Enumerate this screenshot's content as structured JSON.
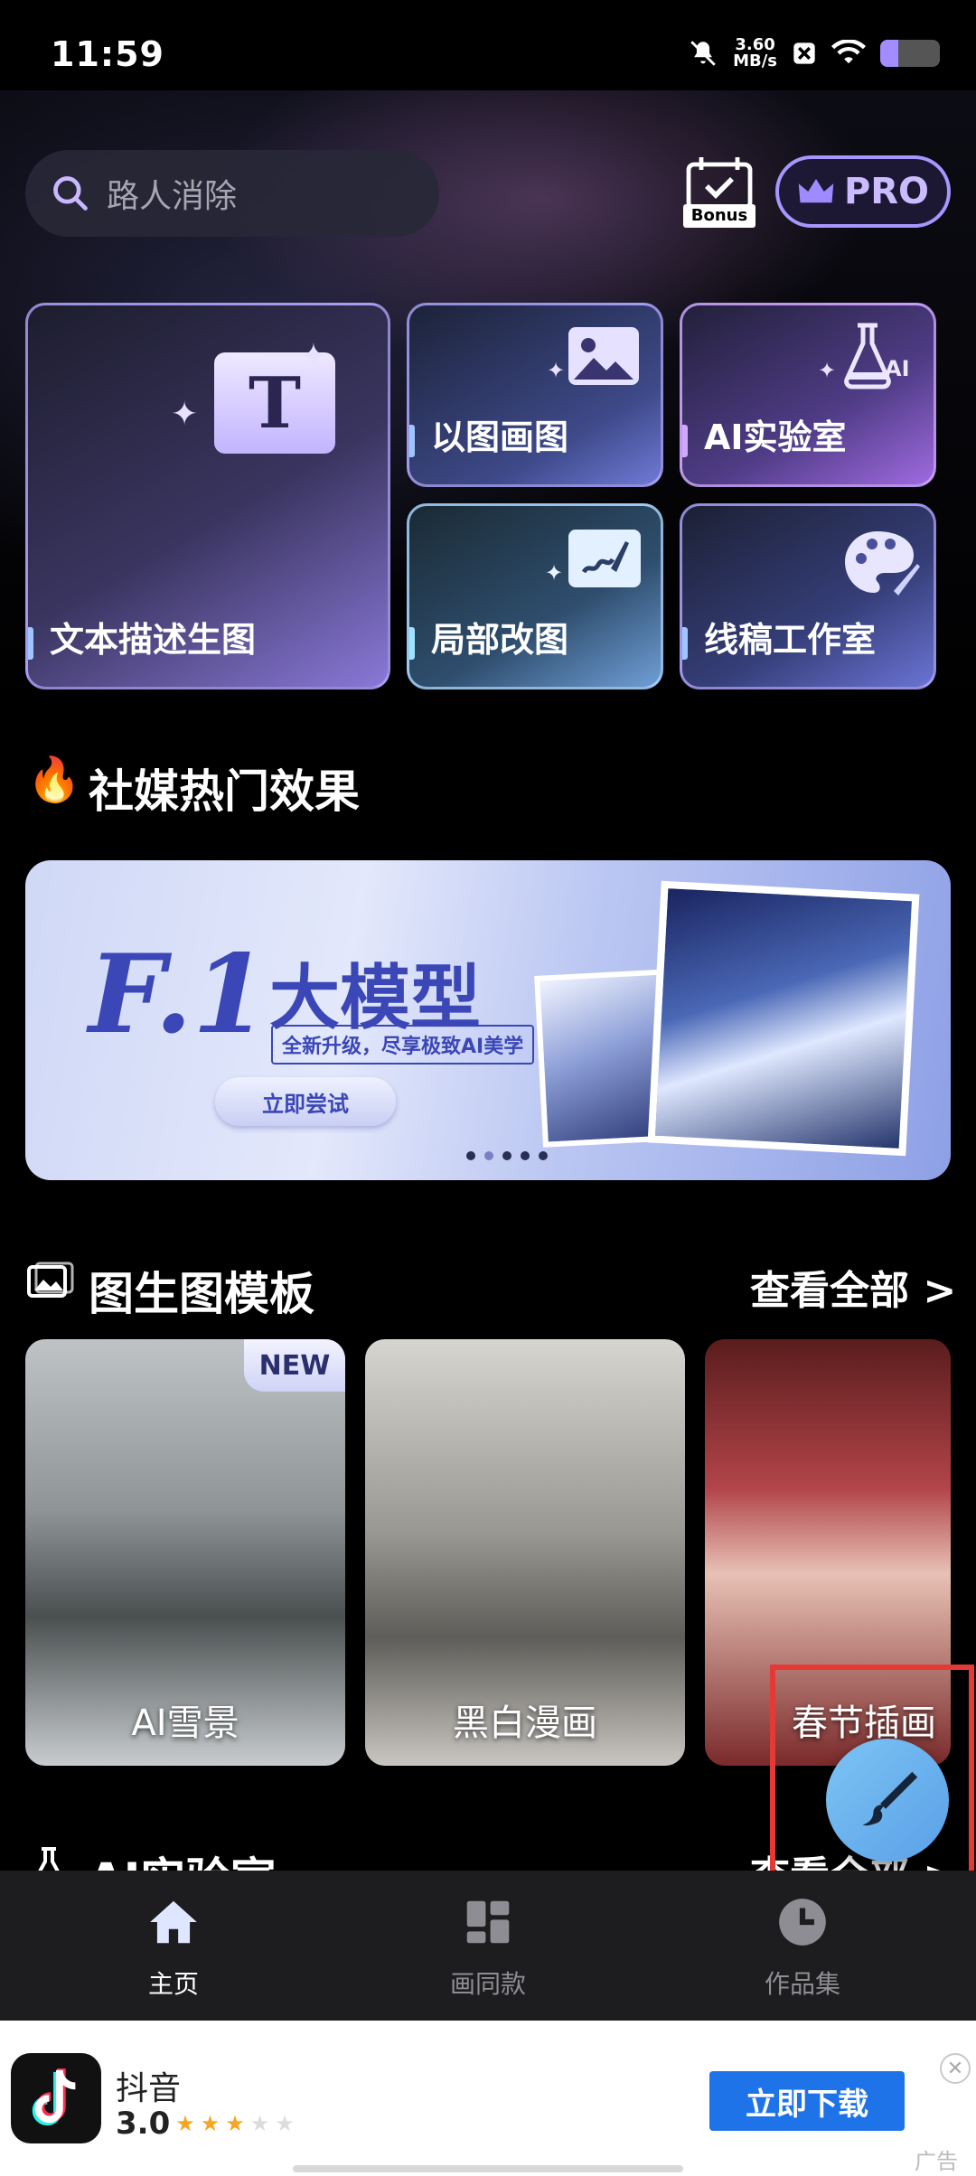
{
  "status_bar": {
    "time": "11:59",
    "net_speed_value": "3.60",
    "net_speed_unit": "MB/s"
  },
  "header": {
    "search_placeholder": "路人消除",
    "bonus_label": "Bonus",
    "pro_label": "PRO"
  },
  "features": [
    {
      "label": "文本描述生图"
    },
    {
      "label": "以图画图"
    },
    {
      "label": "AI实验室"
    },
    {
      "label": "局部改图"
    },
    {
      "label": "线稿工作室"
    }
  ],
  "social": {
    "title": "社媒热门效果"
  },
  "banner": {
    "logo": "F.1",
    "title": "大模型",
    "subtitle": "全新升级，尽享极致AI美学",
    "cta": "立即尝试",
    "page_count": 5,
    "active_index": 1
  },
  "templates": {
    "title": "图生图模板",
    "see_all": "查看全部 >",
    "items": [
      {
        "label": "AI雪景",
        "badge": "NEW"
      },
      {
        "label": "黑白漫画"
      },
      {
        "label": "春节插画"
      }
    ]
  },
  "ai_lab": {
    "title": "AI实验室",
    "see_all": "查看全部 >"
  },
  "nav": [
    {
      "label": "主页",
      "icon": "home-icon",
      "active": true
    },
    {
      "label": "画同款",
      "icon": "grid-icon",
      "active": false
    },
    {
      "label": "作品集",
      "icon": "clock-icon",
      "active": false
    }
  ],
  "ad": {
    "app_name": "抖音",
    "rating": "3.0",
    "stars": 3,
    "cta": "立即下载",
    "tag": "广告"
  },
  "colors": {
    "accent": "#a896ff",
    "nav_active": "#ffffff",
    "nav_inactive": "#8d8d93",
    "ad_button": "#1e73e8"
  }
}
